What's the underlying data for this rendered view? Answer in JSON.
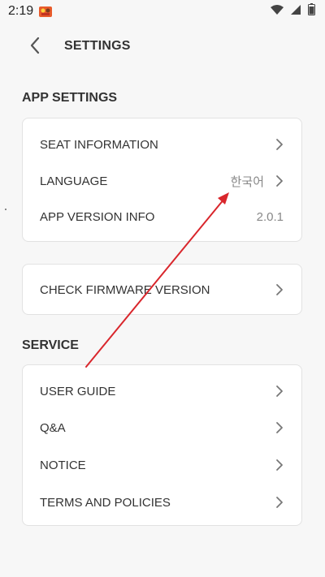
{
  "status_bar": {
    "time": "2:19",
    "icons": [
      "app-notification-icon",
      "wifi-icon",
      "signal-icon",
      "battery-icon"
    ]
  },
  "header": {
    "title": "SETTINGS",
    "back_icon": "chevron-left-icon"
  },
  "app_settings": {
    "title": "APP SETTINGS",
    "items": [
      {
        "label": "SEAT INFORMATION",
        "value": "",
        "chevron": true
      },
      {
        "label": "LANGUAGE",
        "value": "한국어",
        "chevron": true
      },
      {
        "label": "APP VERSION INFO",
        "value": "2.0.1",
        "chevron": false
      }
    ]
  },
  "firmware": {
    "label": "CHECK FIRMWARE VERSION"
  },
  "service": {
    "title": "SERVICE",
    "items": [
      {
        "label": "USER GUIDE"
      },
      {
        "label": "Q&A"
      },
      {
        "label": "NOTICE"
      },
      {
        "label": "TERMS AND POLICIES"
      }
    ]
  },
  "colors": {
    "background": "#f7f7f7",
    "card": "#ffffff",
    "annotation_arrow": "#d9262c"
  }
}
